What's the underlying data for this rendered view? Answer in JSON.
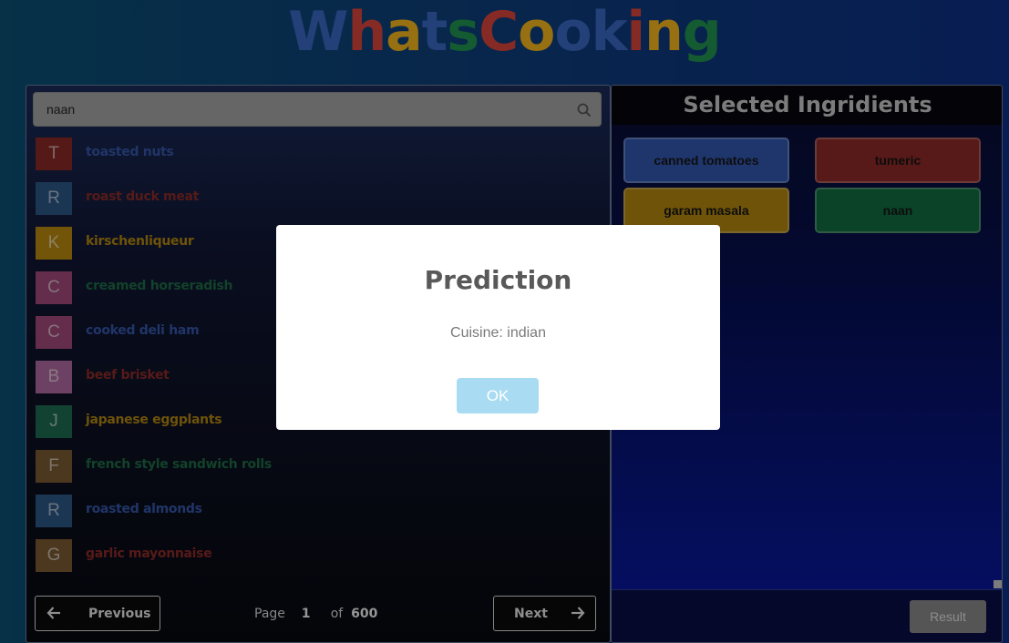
{
  "app": {
    "title_letters": [
      {
        "ch": "W",
        "color": "#3a68c4"
      },
      {
        "ch": "h",
        "color": "#d8453c"
      },
      {
        "ch": "a",
        "color": "#f2b51c"
      },
      {
        "ch": "t",
        "color": "#3a68c4"
      },
      {
        "ch": "s",
        "color": "#21934f"
      },
      {
        "ch": "C",
        "color": "#d8453c"
      },
      {
        "ch": "o",
        "color": "#f2b51c"
      },
      {
        "ch": "o",
        "color": "#3a68c4"
      },
      {
        "ch": "k",
        "color": "#3a68c4"
      },
      {
        "ch": "i",
        "color": "#d8453c"
      },
      {
        "ch": "n",
        "color": "#f2b51c"
      },
      {
        "ch": "g",
        "color": "#21934f"
      }
    ]
  },
  "search": {
    "value": "naan",
    "icon": "search-icon"
  },
  "ingredients": [
    {
      "letter": "T",
      "name": "toasted nuts",
      "avatar_color": "#8a2a27",
      "text_color": "#3456a8"
    },
    {
      "letter": "R",
      "name": "roast duck meat",
      "avatar_color": "#2d5786",
      "text_color": "#8b2b27"
    },
    {
      "letter": "K",
      "name": "kirschenliqueur",
      "avatar_color": "#b88a10",
      "text_color": "#b2870f"
    },
    {
      "letter": "C",
      "name": "creamed horseradish",
      "avatar_color": "#a04a79",
      "text_color": "#1d6b45"
    },
    {
      "letter": "C",
      "name": "cooked deli ham",
      "avatar_color": "#a04a79",
      "text_color": "#3456a8"
    },
    {
      "letter": "B",
      "name": "beef brisket",
      "avatar_color": "#b06aa0",
      "text_color": "#8b2b27"
    },
    {
      "letter": "J",
      "name": "japanese eggplants",
      "avatar_color": "#1d6b4f",
      "text_color": "#b2870f"
    },
    {
      "letter": "F",
      "name": "french style sandwich rolls",
      "avatar_color": "#7b5a33",
      "text_color": "#1d6b45"
    },
    {
      "letter": "R",
      "name": "roasted almonds",
      "avatar_color": "#2d5786",
      "text_color": "#3456a8"
    },
    {
      "letter": "G",
      "name": "garlic mayonnaise",
      "avatar_color": "#7b5a33",
      "text_color": "#8b2b27"
    }
  ],
  "pager": {
    "previous_label": "Previous",
    "next_label": "Next",
    "page_label": "Page",
    "page_number": "1",
    "of_label": "of",
    "total_pages": "600"
  },
  "selected": {
    "heading": "Selected Ingridients",
    "chips": [
      {
        "label": "canned tomatoes",
        "color": "#3358b0"
      },
      {
        "label": "tumeric",
        "color": "#8e2a28"
      },
      {
        "label": "garam masala",
        "color": "#b2870f"
      },
      {
        "label": "naan",
        "color": "#136d42"
      }
    ],
    "result_label": "Result"
  },
  "modal": {
    "title": "Prediction",
    "text": "Cuisine: indian",
    "ok_label": "OK"
  }
}
